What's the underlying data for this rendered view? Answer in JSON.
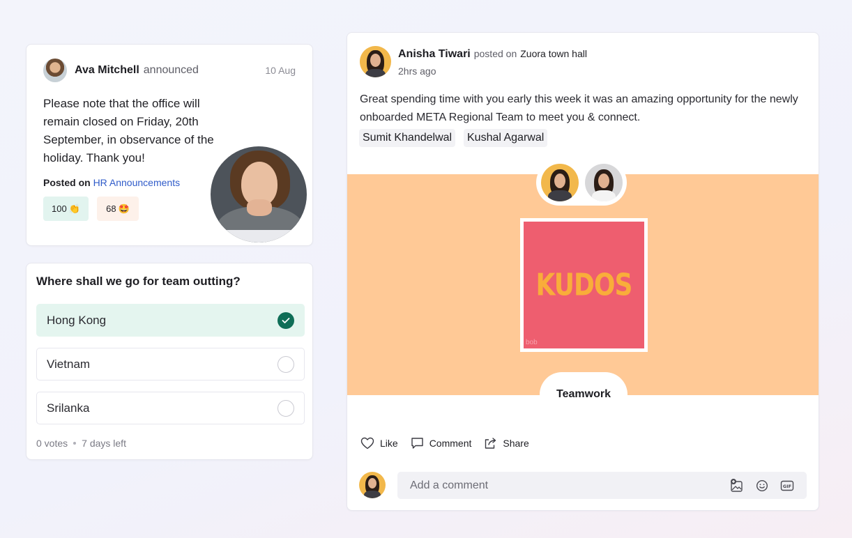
{
  "announcement": {
    "author": "Ava Mitchell",
    "verb": "announced",
    "date": "10 Aug",
    "body": "Please note that the office will remain closed on Friday, 20th September, in observance of the holiday. Thank you!",
    "posted_label": "Posted on",
    "channel": "HR Announcements",
    "reactions": [
      {
        "count": "100",
        "emoji": "👏"
      },
      {
        "count": "68",
        "emoji": "🤩"
      }
    ]
  },
  "poll": {
    "question": "Where shall we go for team outting?",
    "options": [
      {
        "label": "Hong Kong",
        "selected": true
      },
      {
        "label": "Vietnam",
        "selected": false
      },
      {
        "label": "Srilanka",
        "selected": false
      }
    ],
    "votes": "0 votes",
    "time_left": "7 days left"
  },
  "post": {
    "author": "Anisha Tiwari",
    "verb": "posted on",
    "channel": "Zuora town hall",
    "time": "2hrs ago",
    "text": "Great spending time with you early this week it was an amazing opportunity for the newly onboarded META Regional Team to meet you & connect.",
    "tags": [
      "Sumit Khandelwal",
      "Kushal Agarwal"
    ],
    "kudos": {
      "word": "KUDOS",
      "brand": "bob",
      "value": "Teamwork",
      "band_color": "#ffc996",
      "card_color": "#ee5e6f",
      "word_color": "#f9ad3a"
    },
    "actions": {
      "like": "Like",
      "comment": "Comment",
      "share": "Share"
    },
    "comment_placeholder": "Add a comment",
    "comment_icons": [
      "add-image-icon",
      "emoji-icon",
      "gif-icon"
    ]
  },
  "colors": {
    "accent_green": "#0f6e57",
    "link_blue": "#2f5bc9",
    "selected_bg": "#e4f5ef"
  }
}
